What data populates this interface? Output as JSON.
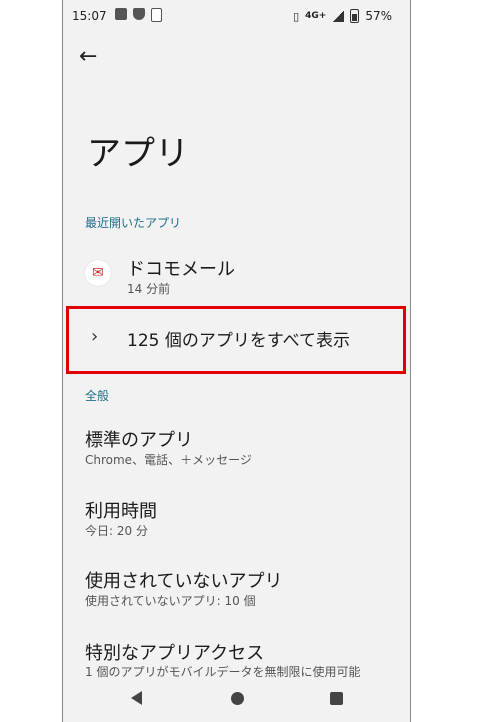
{
  "status": {
    "time": "15:07",
    "network": "4G+",
    "battery": "57%"
  },
  "header": {
    "title": "アプリ"
  },
  "recent": {
    "section_label": "最近開いたアプリ",
    "apps": [
      {
        "name": "ドコモメール",
        "sub": "14 分前"
      }
    ],
    "show_all": "125 個のアプリをすべて表示"
  },
  "general": {
    "section_label": "全般",
    "items": [
      {
        "title": "標準のアプリ",
        "sub": "Chrome、電話、＋メッセージ"
      },
      {
        "title": "利用時間",
        "sub": "今日: 20 分"
      },
      {
        "title": "使用されていないアプリ",
        "sub": "使用されていないアプリ: 10 個"
      },
      {
        "title": "特別なアプリアクセス",
        "sub": "1 個のアプリがモバイルデータを無制限に使用可能"
      }
    ]
  },
  "colors": {
    "highlight": "#e00000",
    "section_label": "#1e6f8a",
    "mail_icon": "#d32f2f"
  }
}
